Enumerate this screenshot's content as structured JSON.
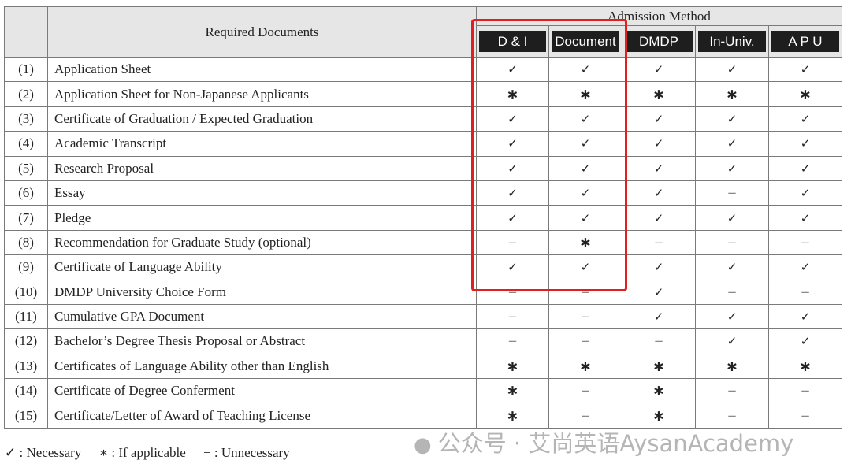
{
  "header": {
    "required_documents": "Required Documents",
    "admission_method": "Admission Method",
    "methods": [
      "D & I",
      "Document",
      "DMDP",
      "In-Univ.",
      "A P U"
    ]
  },
  "rows": [
    {
      "num": "(1)",
      "label": "Application Sheet",
      "marks": [
        "✓",
        "✓",
        "✓",
        "✓",
        "✓"
      ]
    },
    {
      "num": "(2)",
      "label": "Application Sheet for Non-Japanese Applicants",
      "marks": [
        "∗",
        "∗",
        "∗",
        "∗",
        "∗"
      ]
    },
    {
      "num": "(3)",
      "label": "Certificate of Graduation / Expected Graduation",
      "marks": [
        "✓",
        "✓",
        "✓",
        "✓",
        "✓"
      ]
    },
    {
      "num": "(4)",
      "label": "Academic Transcript",
      "marks": [
        "✓",
        "✓",
        "✓",
        "✓",
        "✓"
      ]
    },
    {
      "num": "(5)",
      "label": "Research Proposal",
      "marks": [
        "✓",
        "✓",
        "✓",
        "✓",
        "✓"
      ]
    },
    {
      "num": "(6)",
      "label": "Essay",
      "marks": [
        "✓",
        "✓",
        "✓",
        "−",
        "✓"
      ]
    },
    {
      "num": "(7)",
      "label": "Pledge",
      "marks": [
        "✓",
        "✓",
        "✓",
        "✓",
        "✓"
      ]
    },
    {
      "num": "(8)",
      "label": "Recommendation for Graduate Study (optional)",
      "marks": [
        "−",
        "∗",
        "−",
        "−",
        "−"
      ]
    },
    {
      "num": "(9)",
      "label": "Certificate of Language Ability",
      "marks": [
        "✓",
        "✓",
        "✓",
        "✓",
        "✓"
      ]
    },
    {
      "num": "(10)",
      "label": "DMDP University Choice Form",
      "marks": [
        "−",
        "−",
        "✓",
        "−",
        "−"
      ]
    },
    {
      "num": "(11)",
      "label": "Cumulative GPA Document",
      "marks": [
        "−",
        "−",
        "✓",
        "✓",
        "✓"
      ]
    },
    {
      "num": "(12)",
      "label": "Bachelor’s Degree Thesis Proposal or Abstract",
      "marks": [
        "−",
        "−",
        "−",
        "✓",
        "✓"
      ]
    },
    {
      "num": "(13)",
      "label": "Certificates of Language Ability other than English",
      "marks": [
        "∗",
        "∗",
        "∗",
        "∗",
        "∗"
      ]
    },
    {
      "num": "(14)",
      "label": "Certificate of Degree Conferment",
      "marks": [
        "∗",
        "−",
        "∗",
        "−",
        "−"
      ]
    },
    {
      "num": "(15)",
      "label": "Certificate/Letter of Award of Teaching License",
      "marks": [
        "∗",
        "−",
        "∗",
        "−",
        "−"
      ]
    }
  ],
  "legend": {
    "necessary": "✓ : Necessary",
    "if_applicable": "∗ : If applicable",
    "unnecessary": "− : Unnecessary"
  },
  "watermark": "公众号 · 艾尚英语AysanAcademy",
  "highlight_color": "#e01f1f"
}
